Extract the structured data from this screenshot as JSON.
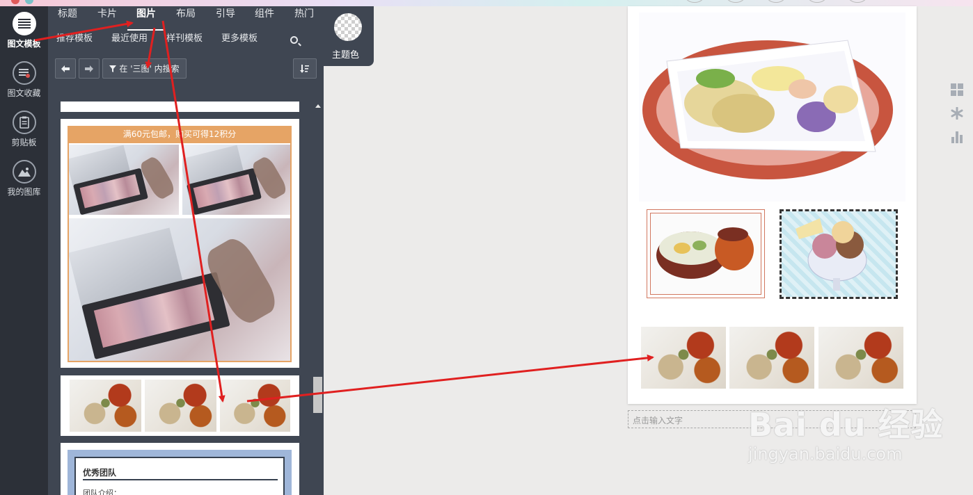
{
  "rail": {
    "items": [
      {
        "label": "图文模板",
        "active": true
      },
      {
        "label": "图文收藏"
      },
      {
        "label": "剪贴板"
      },
      {
        "label": "我的图库"
      }
    ]
  },
  "tabs": [
    "标题",
    "卡片",
    "图片",
    "布局",
    "引导",
    "组件",
    "热门"
  ],
  "active_tab": "图片",
  "subtabs": [
    "推荐模板",
    "最近使用",
    "样刊模板",
    "更多模板"
  ],
  "theme": {
    "label": "主题色"
  },
  "toolbar": {
    "filter_label": "在 '三图' 内搜索"
  },
  "cards": {
    "banner_text": "满60元包邮，购买可得12积分",
    "team_title": "优秀团队",
    "team_intro": "团队介绍："
  },
  "canvas": {
    "input_placeholder": "点击输入文字"
  },
  "watermark": {
    "brand": "Bai du 经验",
    "url": "jingyan.baidu.com"
  },
  "colors": {
    "rail": "#2c3038",
    "panel": "#3f4652",
    "arrow": "#e02020",
    "orange": "#e6a465",
    "team_border": "#9fb6d9"
  }
}
